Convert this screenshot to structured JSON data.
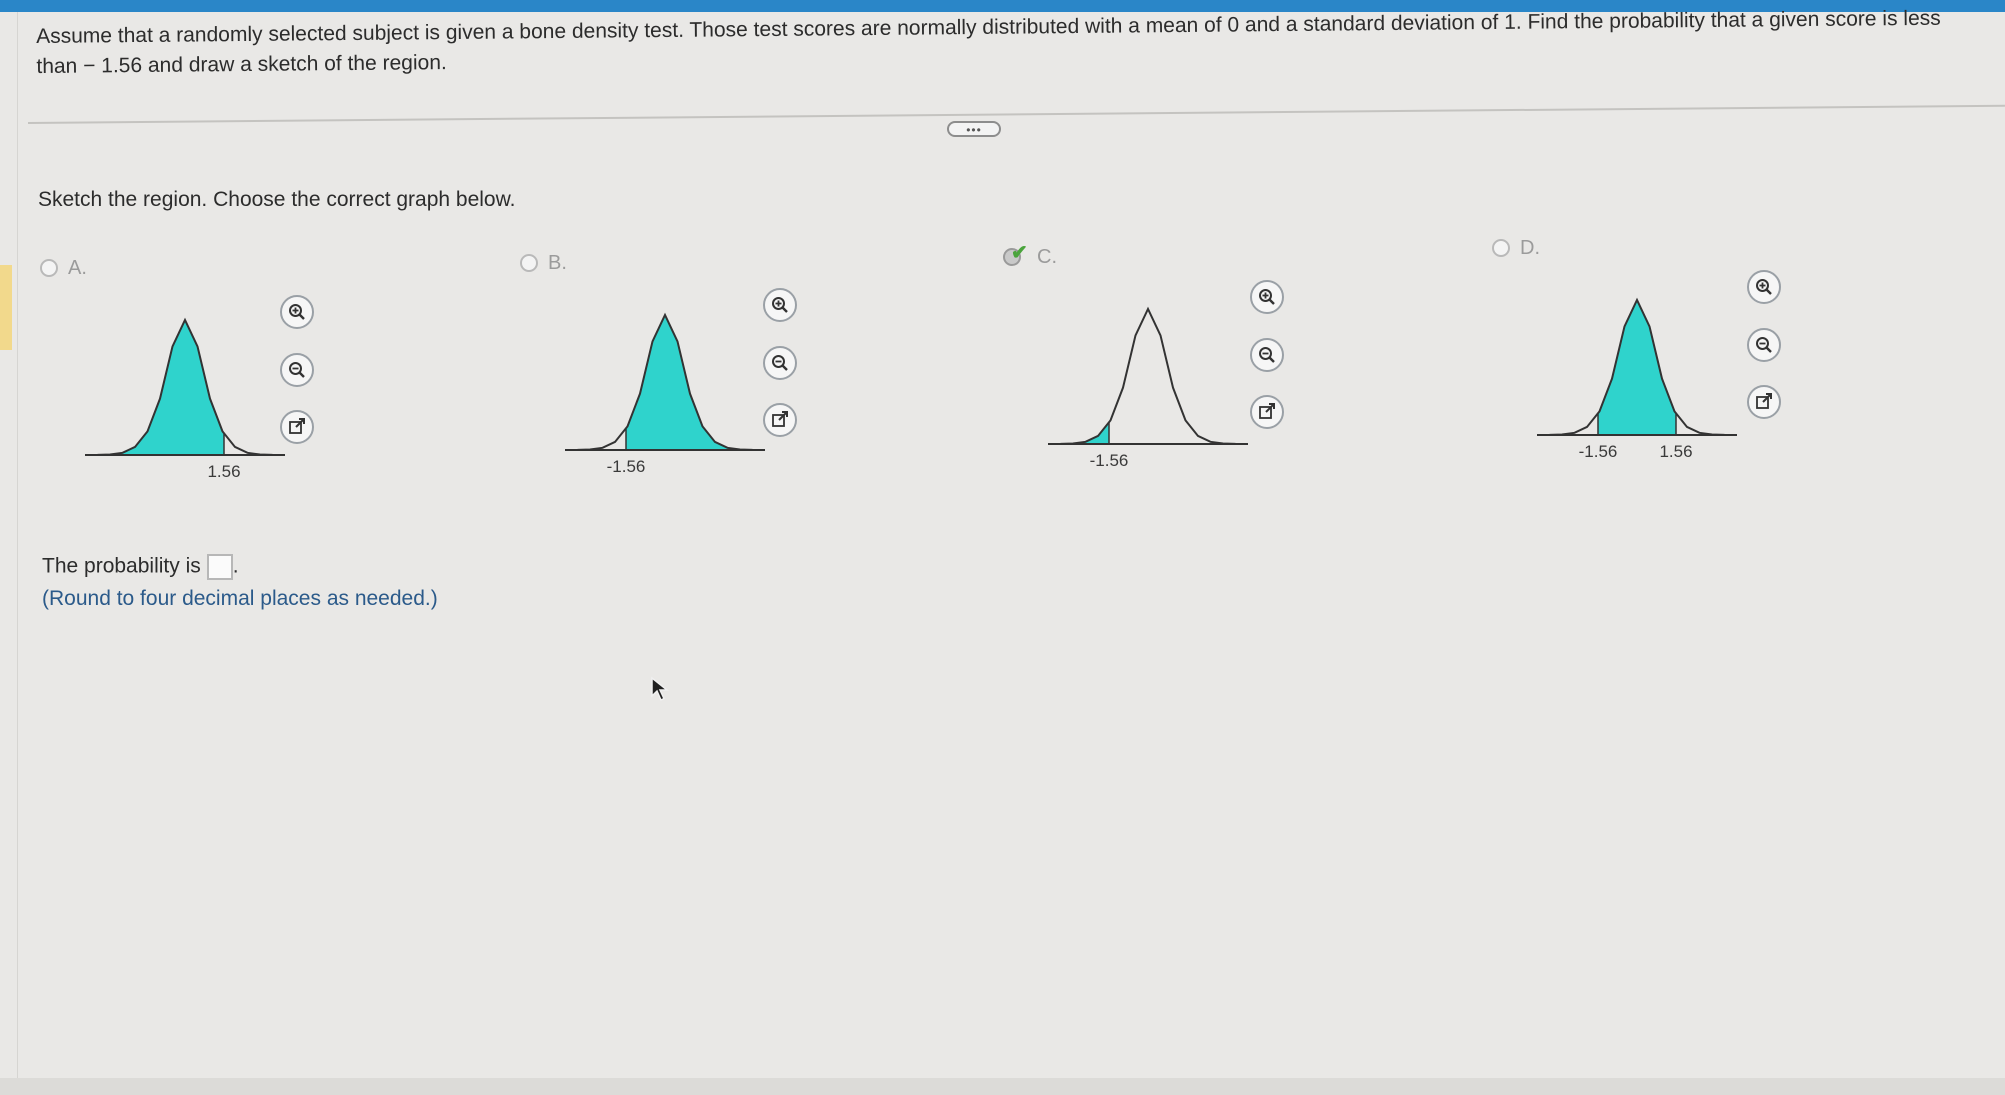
{
  "question": {
    "text": "Assume that a randomly selected subject is given a bone density test. Those test scores are normally distributed with a mean of 0 and a standard deviation of 1. Find the probability that a given score is less than  − 1.56 and draw a sketch of the region."
  },
  "more_button": {
    "label": "•••"
  },
  "prompt": "Sketch the region. Choose the correct graph below.",
  "options": [
    {
      "letter": "A.",
      "tick_labels": [
        "1.56"
      ],
      "selected": false,
      "shaded": "below 1.56"
    },
    {
      "letter": "B.",
      "tick_labels": [
        "-1.56"
      ],
      "selected": false,
      "shaded": "above -1.56"
    },
    {
      "letter": "C.",
      "tick_labels": [
        "-1.56"
      ],
      "selected": true,
      "correct": true,
      "shaded": "below -1.56"
    },
    {
      "letter": "D.",
      "tick_labels": [
        "-1.56",
        "1.56"
      ],
      "selected": false,
      "shaded": "between -1.56 and 1.56"
    }
  ],
  "tools": [
    "zoom-in-icon",
    "zoom-out-icon",
    "open-external-icon"
  ],
  "answer": {
    "label": "The probability is",
    "value": "",
    "suffix": ".",
    "note": "(Round to four decimal places as needed.)"
  },
  "colors": {
    "shade": "#2fd3cc",
    "curve": "#333333",
    "accent": "#2a86c8",
    "check": "#4aa43c"
  }
}
